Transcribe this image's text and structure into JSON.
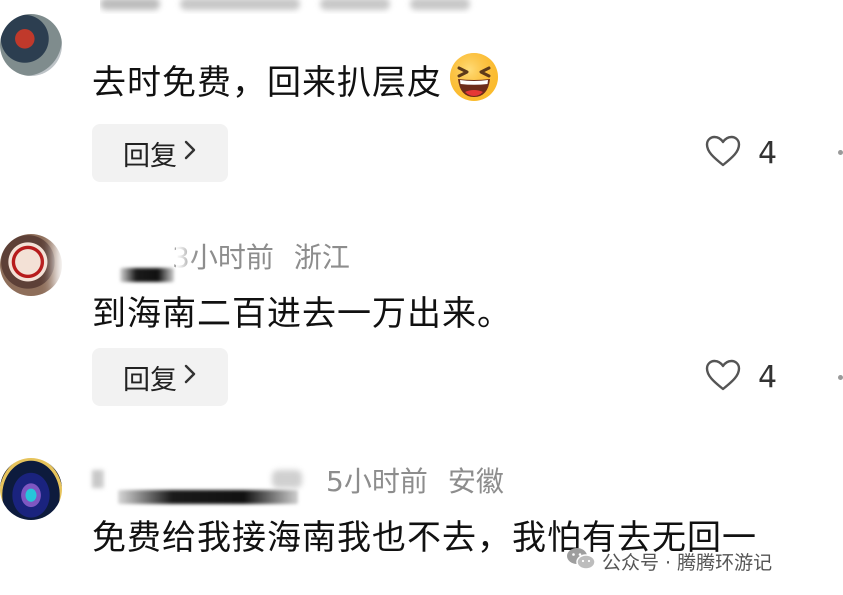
{
  "comments": [
    {
      "meta_partial": "",
      "location": "",
      "time": "",
      "content": "去时免费，回来扒层皮",
      "emoji": "grinning-squinting-face",
      "reply_label": "回复",
      "likes": "4"
    },
    {
      "time": "3小时前",
      "location": "浙江",
      "content": "到海南二百进去一万出来。",
      "reply_label": "回复",
      "likes": "4"
    },
    {
      "time": "5小时前",
      "location": "安徽",
      "content": "免费给我接海南我也不去，我怕有去无回一"
    }
  ],
  "watermark": {
    "text": "公众号 · 腾腾环游记",
    "icon": "wechat-icon"
  },
  "icons": {
    "like": "heart-outline-icon",
    "chevron": "chevron-right-icon"
  },
  "colors": {
    "meta_text": "#8d8d8d",
    "body_text": "#111111",
    "reply_bg": "#f2f2f2",
    "emoji_yellow": "#fbc02d"
  }
}
